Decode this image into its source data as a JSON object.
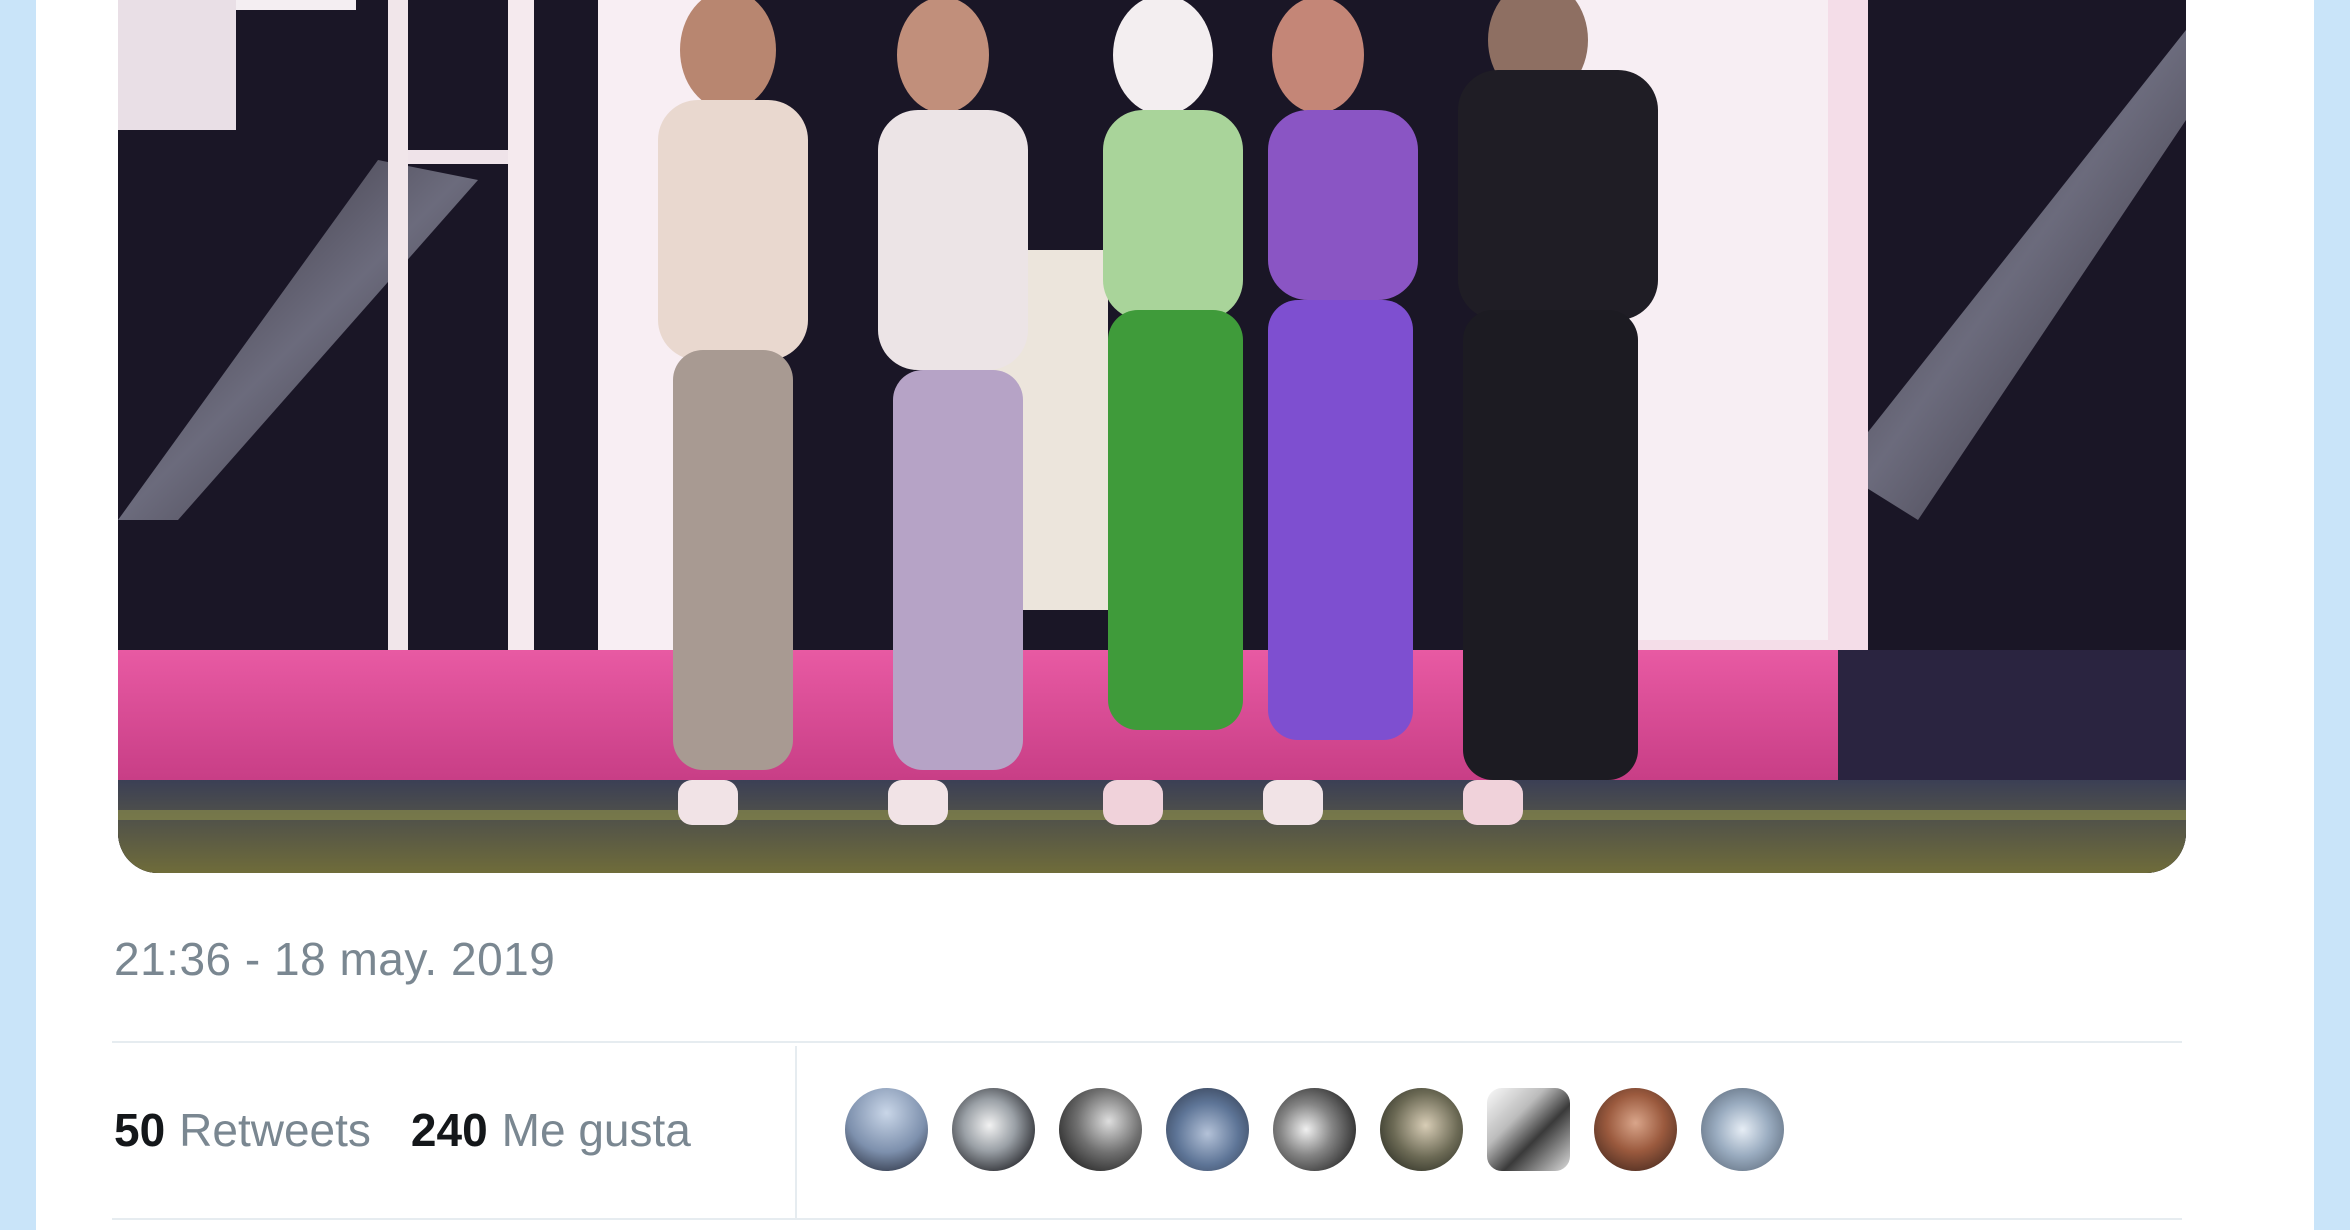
{
  "tweet": {
    "media": {
      "description_icon": "stage-photo"
    },
    "timestamp": "21:36 - 18 may. 2019",
    "stats": {
      "retweets_count": "50",
      "retweets_label": "Retweets",
      "likes_count": "240",
      "likes_label": "Me gusta"
    },
    "liker_avatars": [
      "avatar-1",
      "avatar-2",
      "avatar-3",
      "avatar-4",
      "avatar-5",
      "avatar-6",
      "avatar-7",
      "avatar-8",
      "avatar-9"
    ]
  },
  "colors": {
    "frame": "#c9e4f9",
    "muted_text": "#7a8791",
    "strong_text": "#14171a",
    "divider": "#e6ecf0"
  }
}
